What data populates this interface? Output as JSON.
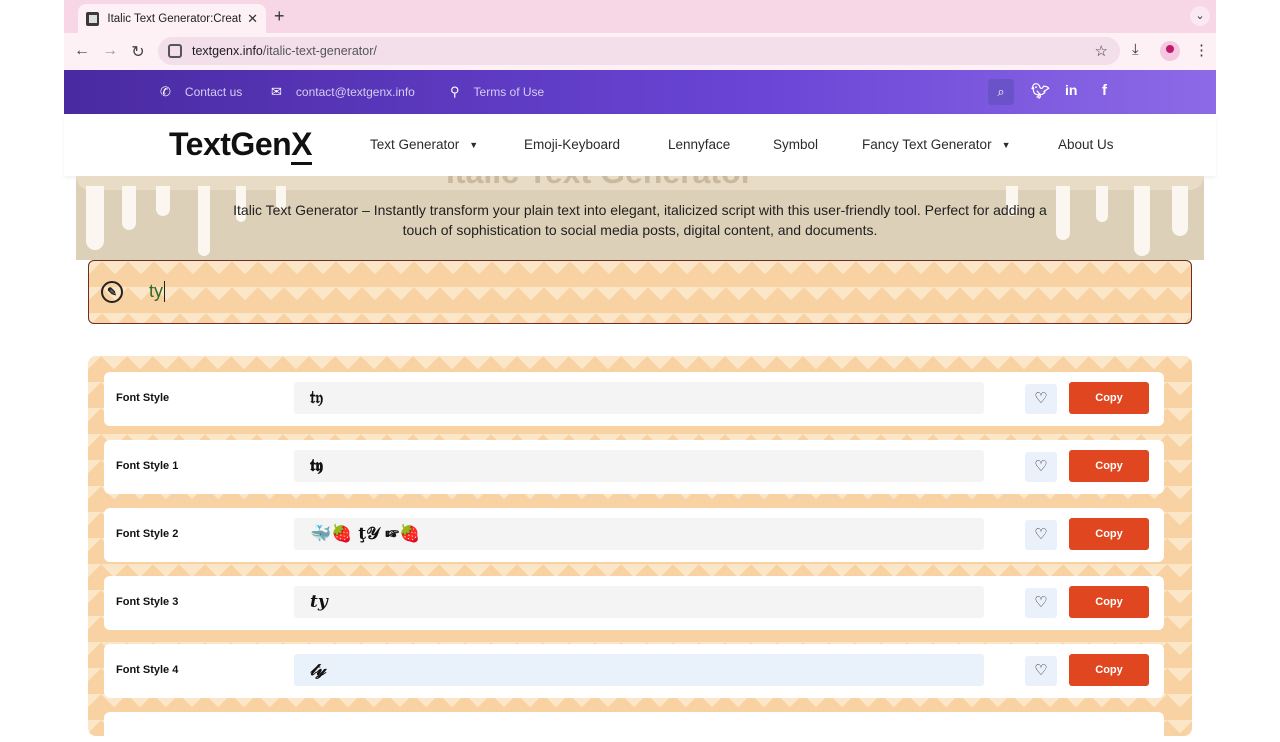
{
  "browser": {
    "tab_title": "Italic Text Generator:Create It",
    "tab_close": "✕",
    "new_tab": "+",
    "url_host": "textgenx.info",
    "url_path": "/italic-text-generator/"
  },
  "topbar": {
    "contact_us": "Contact us",
    "email": "contact@textgenx.info",
    "terms": "Terms of Use",
    "icons": [
      "phone-icon",
      "envelope-icon",
      "map-pin-icon",
      "search-icon",
      "twitter-icon",
      "linkedin-icon",
      "facebook-icon"
    ],
    "gradient_colors": [
      "#4a2aa1",
      "#8d6ae6"
    ]
  },
  "header": {
    "logo": "TextGenX",
    "logo_main": "TextGen",
    "logo_x": "X",
    "nav": {
      "text_generator": "Text Generator",
      "emoji_keyboard": "Emoji-Keyboard",
      "lennyface": "Lennyface",
      "symbol": "Symbol",
      "fancy_text_generator": "Fancy Text Generator",
      "about_us": "About Us"
    }
  },
  "hero": {
    "title": "Italic Text Generator",
    "description": "Italic Text Generator – Instantly transform your plain text into elegant, italicized script with this user-friendly tool. Perfect for adding a touch of sophistication to social media posts, digital content, and documents."
  },
  "input": {
    "value": "ty"
  },
  "results": {
    "copy_label": "Copy",
    "rows": [
      {
        "label": "Font Style",
        "output": "𝔱𝔶"
      },
      {
        "label": "Font Style 1",
        "output": "𝖙𝖞"
      },
      {
        "label": "Font Style 2",
        "output": "🐳🍓  ţ𝒴  ☞🍓"
      },
      {
        "label": "Font Style 3",
        "output": "𝒕𝒚"
      },
      {
        "label": "Font Style 4",
        "output": "𝓉𝓎"
      }
    ]
  },
  "colors": {
    "accent_copy": "#e0461f",
    "pattern_dark": "#f8d2a3",
    "pattern_light": "#fbe6c8",
    "input_border": "#6b2d25"
  }
}
